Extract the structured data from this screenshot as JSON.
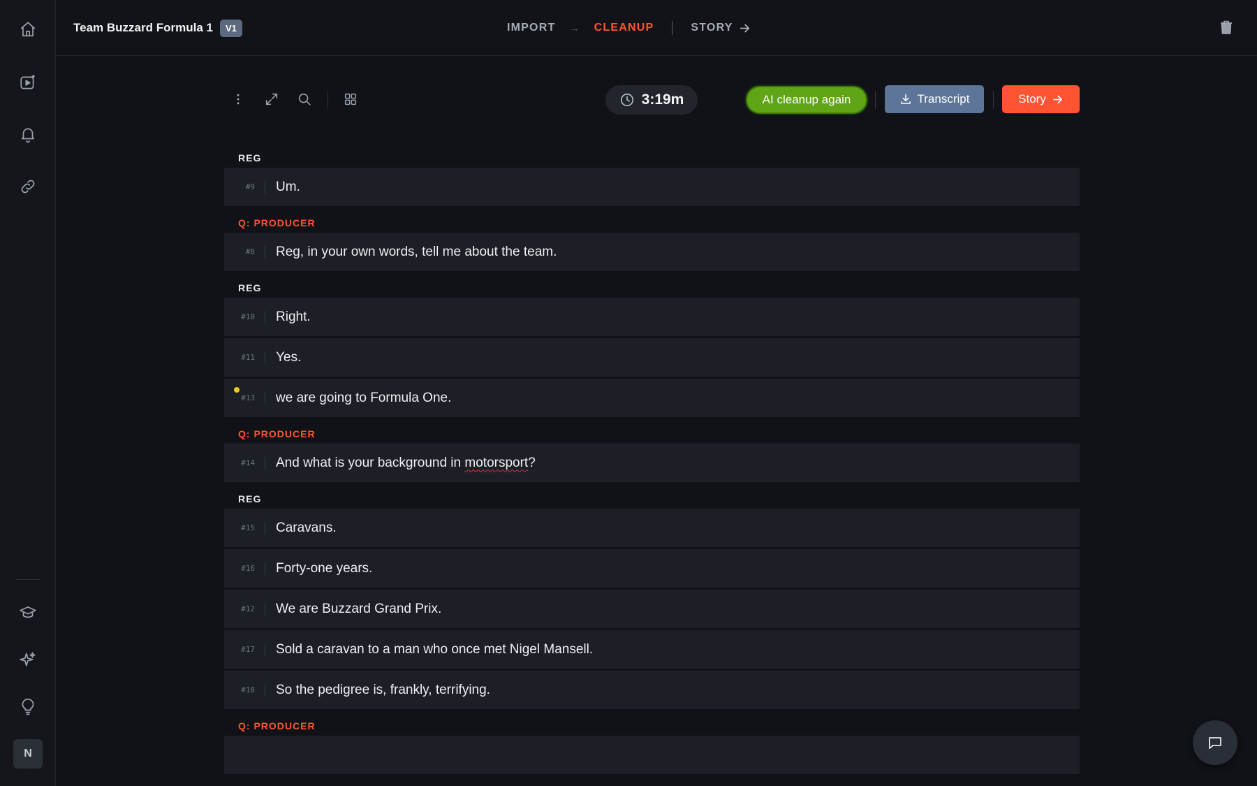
{
  "header": {
    "project_title": "Team Buzzard Formula 1",
    "version": "V1",
    "steps": {
      "import": "IMPORT",
      "cleanup": "CLEANUP",
      "story": "STORY"
    }
  },
  "toolbar": {
    "duration": "3:19m",
    "ai_cleanup_label": "AI cleanup again",
    "transcript_label": "Transcript",
    "story_label": "Story"
  },
  "user": {
    "initial": "N"
  },
  "transcript": {
    "b1": {
      "speaker": "REG",
      "l1": {
        "num": "#9",
        "text": "Um."
      }
    },
    "b2": {
      "speaker": "Q: PRODUCER",
      "l1": {
        "num": "#8",
        "text": "Reg, in your own words, tell me about the team."
      }
    },
    "b3": {
      "speaker": "REG",
      "l1": {
        "num": "#10",
        "text": "Right."
      },
      "l2": {
        "num": "#11",
        "text": "Yes."
      },
      "l3": {
        "num": "#13",
        "text": "we are going to Formula One."
      }
    },
    "b4": {
      "speaker": "Q: PRODUCER",
      "l1": {
        "num": "#14",
        "text_before": "And what is your background in ",
        "text_flagged": "motorsport",
        "text_after": "?"
      }
    },
    "b5": {
      "speaker": "REG",
      "l1": {
        "num": "#15",
        "text": "Caravans."
      },
      "l2": {
        "num": "#16",
        "text": "Forty-one years."
      },
      "l3": {
        "num": "#12",
        "text": "We are Buzzard Grand Prix."
      },
      "l4": {
        "num": "#17",
        "text": "Sold a caravan to a man who once met Nigel Mansell."
      },
      "l5": {
        "num": "#18",
        "text": "So the pedigree is, frankly, terrifying."
      }
    },
    "b6": {
      "speaker": "Q: PRODUCER"
    }
  },
  "colors": {
    "accent": "#ff5530",
    "ai_green": "#5fa516",
    "transcript_blue": "#5c7598",
    "marker_yellow": "#f5c518"
  }
}
